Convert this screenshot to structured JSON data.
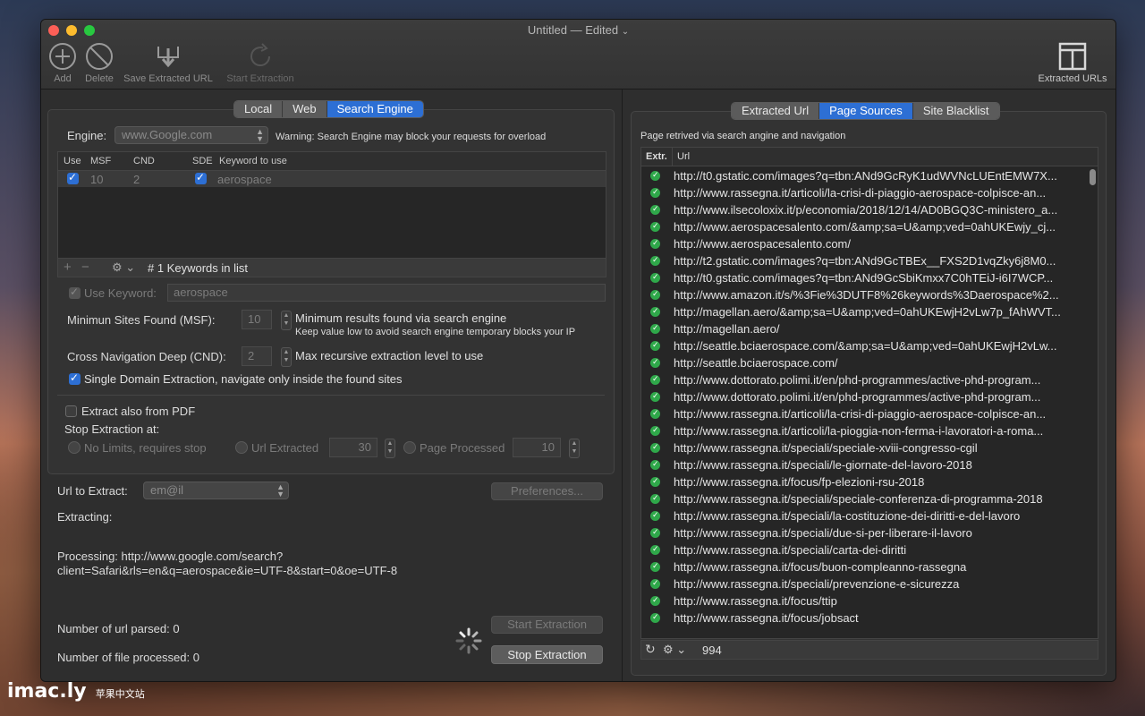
{
  "window": {
    "title": "Untitled — Edited",
    "title_arrow": "⌄"
  },
  "toolbar": {
    "add": "Add",
    "delete": "Delete",
    "save": "Save Extracted URL",
    "start": "Start Extraction",
    "extracted_urls": "Extracted URLs"
  },
  "left": {
    "tabs": [
      "Local",
      "Web",
      "Search Engine"
    ],
    "active_tab": "Search Engine",
    "engine_label": "Engine:",
    "engine_value": "www.Google.com",
    "engine_warning": "Warning: Search Engine may block your requests for overload",
    "table_headers": [
      "Use",
      "MSF",
      "CND",
      "SDE",
      "Keyword to use"
    ],
    "row": {
      "msf": "10",
      "cnd": "2",
      "keyword": "aerospace"
    },
    "keywords_count": "# 1 Keywords in list",
    "use_keyword_label": "Use Keyword:",
    "use_keyword_value": "aerospace",
    "msf_label": "Minimun Sites Found (MSF):",
    "msf_value": "10",
    "msf_desc": "Minimum results found via search engine",
    "msf_note": "Keep value low to avoid search engine temporary blocks your IP",
    "cnd_label": "Cross Navigation Deep (CND):",
    "cnd_value": "2",
    "cnd_desc": "Max recursive extraction level to use",
    "sde_label": "Single Domain Extraction, navigate only inside the found sites",
    "pdf_label": "Extract also from PDF",
    "stop_label": "Stop Extraction at:",
    "no_limits": "No Limits, requires stop",
    "url_extracted": "Url Extracted",
    "url_extracted_value": "30",
    "page_processed": "Page Processed",
    "page_processed_value": "10",
    "url_to_extract_label": "Url to Extract:",
    "url_to_extract_value": "em@il",
    "preferences": "Preferences...",
    "extracting": "Extracting:",
    "processing_line1": "Processing: http://www.google.com/search?",
    "processing_line2": "client=Safari&rls=en&q=aerospace&ie=UTF-8&start=0&oe=UTF-8",
    "url_parsed": "Number of url parsed: 0",
    "file_processed": "Number of file processed: 0",
    "start_btn": "Start Extraction",
    "stop_btn": "Stop Extraction"
  },
  "right": {
    "tabs": [
      "Extracted Url",
      "Page Sources",
      "Site Blacklist"
    ],
    "active_tab": "Page Sources",
    "caption": "Page retrived via search angine and navigation",
    "headers": [
      "Extr.",
      "Url"
    ],
    "urls": [
      "http://t0.gstatic.com/images?q=tbn:ANd9GcRyK1udWVNcLUEntEMW7X...",
      "http://www.rassegna.it/articoli/la-crisi-di-piaggio-aerospace-colpisce-an...",
      "http://www.ilsecoloxix.it/p/economia/2018/12/14/AD0BGQ3C-ministero_a...",
      "http://www.aerospacesalento.com/&amp;sa=U&amp;ved=0ahUKEwjy_cj...",
      "http://www.aerospacesalento.com/",
      "http://t2.gstatic.com/images?q=tbn:ANd9GcTBEx__FXS2D1vqZky6j8M0...",
      "http://t0.gstatic.com/images?q=tbn:ANd9GcSbiKmxx7C0hTEiJ-i6I7WCP...",
      "http://www.amazon.it/s/%3Fie%3DUTF8%26keywords%3Daerospace%2...",
      "http://magellan.aero/&amp;sa=U&amp;ved=0ahUKEwjH2vLw7p_fAhWVT...",
      "http://magellan.aero/",
      "http://seattle.bciaerospace.com/&amp;sa=U&amp;ved=0ahUKEwjH2vLw...",
      "http://seattle.bciaerospace.com/",
      "http://www.dottorato.polimi.it/en/phd-programmes/active-phd-program...",
      "http://www.dottorato.polimi.it/en/phd-programmes/active-phd-program...",
      "http://www.rassegna.it/articoli/la-crisi-di-piaggio-aerospace-colpisce-an...",
      "http://www.rassegna.it/articoli/la-pioggia-non-ferma-i-lavoratori-a-roma...",
      "http://www.rassegna.it/speciali/speciale-xviii-congresso-cgil",
      "http://www.rassegna.it/speciali/le-giornate-del-lavoro-2018",
      "http://www.rassegna.it/focus/fp-elezioni-rsu-2018",
      "http://www.rassegna.it/speciali/speciale-conferenza-di-programma-2018",
      "http://www.rassegna.it/speciali/la-costituzione-dei-diritti-e-del-lavoro",
      "http://www.rassegna.it/speciali/due-si-per-liberare-il-lavoro",
      "http://www.rassegna.it/speciali/carta-dei-diritti",
      "http://www.rassegna.it/focus/buon-compleanno-rassegna",
      "http://www.rassegna.it/speciali/prevenzione-e-sicurezza",
      "http://www.rassegna.it/focus/ttip",
      "http://www.rassegna.it/focus/jobsact"
    ],
    "count": "994"
  },
  "watermark": {
    "brand": "imac.ly",
    "sub": "苹果中文站"
  },
  "colors": {
    "accent": "#2d6fd4",
    "check_green": "#2fa84a"
  }
}
